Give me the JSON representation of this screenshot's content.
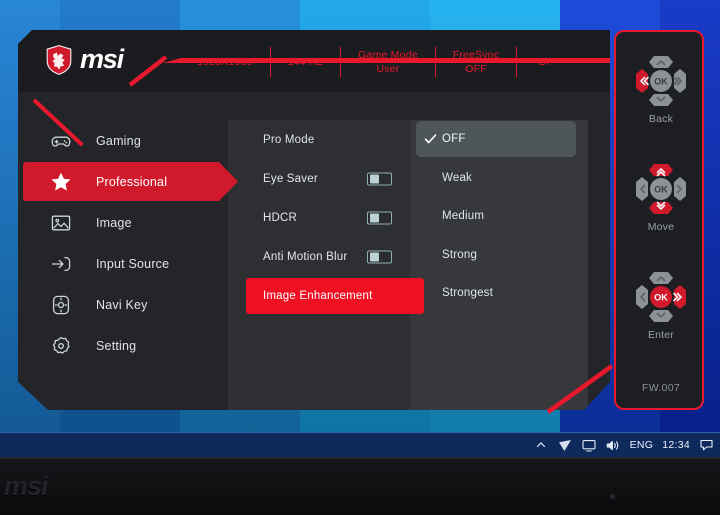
{
  "wallpaper": {
    "description": "blue-bands-desktop"
  },
  "osd": {
    "brand": {
      "logo_icon": "msi-dragon-shield-icon",
      "wordmark": "msi"
    },
    "status_bar": [
      {
        "name": "resolution",
        "text": "1920X1080"
      },
      {
        "name": "refresh-rate",
        "text": "144 HZ"
      },
      {
        "name": "game-mode",
        "text": "Game Mode\nUser"
      },
      {
        "name": "freesync",
        "text": "FreeSync\nOFF"
      },
      {
        "name": "input",
        "text": "DP"
      }
    ],
    "sidebar": {
      "items": [
        {
          "label": "Gaming",
          "icon": "gamepad-icon",
          "active": false
        },
        {
          "label": "Professional",
          "icon": "star-icon",
          "active": true
        },
        {
          "label": "Image",
          "icon": "picture-icon",
          "active": false
        },
        {
          "label": "Input Source",
          "icon": "input-arrow-icon",
          "active": false
        },
        {
          "label": "Navi Key",
          "icon": "dpad-icon",
          "active": false
        },
        {
          "label": "Setting",
          "icon": "gear-icon",
          "active": false
        }
      ]
    },
    "menu": {
      "items": [
        {
          "label": "Pro Mode",
          "type": "submenu",
          "highlight": false
        },
        {
          "label": "Eye Saver",
          "type": "toggle",
          "value": "off",
          "highlight": false
        },
        {
          "label": "HDCR",
          "type": "toggle",
          "value": "off",
          "highlight": false
        },
        {
          "label": "Anti Motion Blur",
          "type": "toggle",
          "value": "off",
          "highlight": false
        },
        {
          "label": "Image Enhancement",
          "type": "submenu",
          "highlight": true
        }
      ]
    },
    "options": {
      "title_of_open_menu": "Image Enhancement",
      "items": [
        {
          "label": "OFF",
          "selected": true
        },
        {
          "label": "Weak",
          "selected": false
        },
        {
          "label": "Medium",
          "selected": false
        },
        {
          "label": "Strong",
          "selected": false
        },
        {
          "label": "Strongest",
          "selected": false
        }
      ]
    },
    "nav_hints": [
      {
        "caption": "Back",
        "icon": "dpad-left-icon"
      },
      {
        "caption": "Move",
        "icon": "dpad-updown-icon"
      },
      {
        "caption": "Enter",
        "icon": "dpad-ok-right-icon"
      }
    ],
    "firmware": "FW.007",
    "colors": {
      "accent_red": "#e8192c",
      "highlight_red": "#ef1122",
      "panel_bg": "#242529",
      "header_bg": "#1b1c20",
      "option_highlight": "#4f565a"
    }
  },
  "taskbar": {
    "icons": [
      {
        "name": "show-hidden-icons",
        "glyph": "chevron-up-icon"
      },
      {
        "name": "network-icon",
        "glyph": "network-icon"
      },
      {
        "name": "display-icon",
        "glyph": "display-icon"
      },
      {
        "name": "volume-icon",
        "glyph": "volume-icon"
      }
    ],
    "language": "ENG",
    "clock": "12:34",
    "action_center_icon": "action-center-icon"
  },
  "bezel": {
    "logo": "msi"
  }
}
